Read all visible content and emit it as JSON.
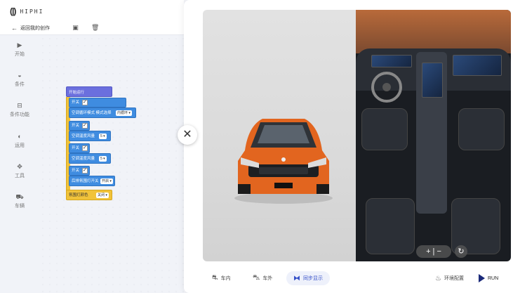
{
  "app": {
    "logo_mark": "(|)",
    "logo_text": "HIPHI"
  },
  "backbar": {
    "back_label": "返回我的创作"
  },
  "sidebar": {
    "items": [
      {
        "label": "开始",
        "icon": "play-icon"
      },
      {
        "label": "条件",
        "icon": "condition-icon"
      },
      {
        "label": "条件功能",
        "icon": "function-icon"
      },
      {
        "label": "运用",
        "icon": "apply-icon"
      },
      {
        "label": "工具",
        "icon": "tools-icon"
      },
      {
        "label": "车辆",
        "icon": "vehicle-icon"
      }
    ]
  },
  "blocks": {
    "event": "开始运行",
    "rows": [
      {
        "toggle": "开关",
        "label": "空调循环模式 模式选择",
        "value": "内循环"
      },
      {
        "toggle": "开关",
        "label": "空调温度风量",
        "value": "5"
      },
      {
        "toggle": "开关",
        "label": "空调温度风量",
        "value": "5"
      },
      {
        "toggle": "开关",
        "label": "后排氛围灯开关",
        "value": "开启"
      }
    ],
    "last": {
      "label": "氛围灯颜色",
      "value": "关闭"
    }
  },
  "viewer": {
    "zoom_label": "+ | −"
  },
  "bottom": {
    "tabs": [
      {
        "label": "车内",
        "icon": "car-interior-icon"
      },
      {
        "label": "车外",
        "icon": "car-exterior-icon"
      },
      {
        "label": "同步显示",
        "icon": "sync-display-icon"
      }
    ],
    "env_label": "环境配置",
    "run_label": "RUN"
  },
  "colors": {
    "accent": "#3550c8",
    "event_block": "#6b6fde",
    "action_block": "#3f8ce0",
    "frame_block": "#f1c33a"
  }
}
